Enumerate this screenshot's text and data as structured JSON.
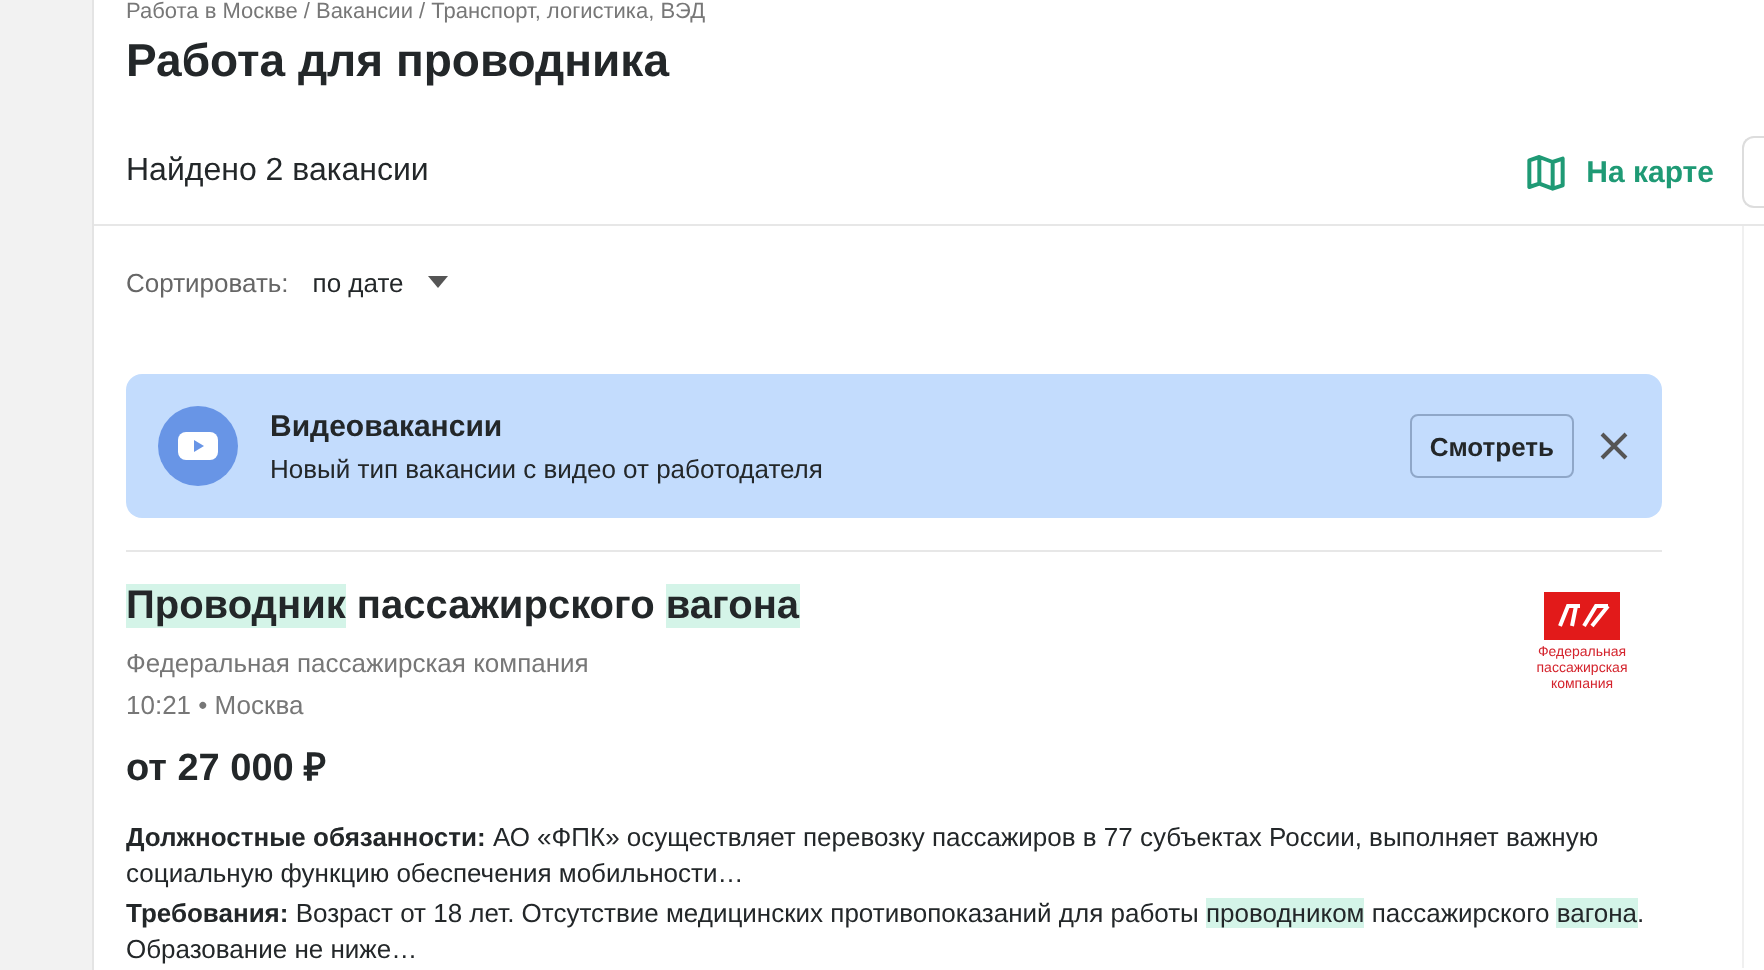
{
  "breadcrumb": "Работа в Москве / Вакансии / Транспорт, логистика, ВЭД",
  "title": "Работа для проводника",
  "found": "Найдено 2 вакансии",
  "map_link": "На карте",
  "sort": {
    "label": "Сортировать:",
    "value": "по дате"
  },
  "banner": {
    "title": "Видеовакансии",
    "text": "Новый тип вакансии с видео от работодателя",
    "button": "Смотреть"
  },
  "vacancy": {
    "title": [
      {
        "text": "Проводник",
        "highlighted": true
      },
      {
        "text": " пассажирского ",
        "highlighted": false
      },
      {
        "text": "вагона",
        "highlighted": true
      }
    ],
    "company": "Федеральная пассажирская компания",
    "logo_caption": "Федеральная пассажирская компания",
    "meta": "10:21 • Москва",
    "salary": "от 27 000 ₽",
    "duties": [
      {
        "text": "**Должностные обязанности:** АО «ФПК» осуществляет перевозку пассажиров в 77 субъектах России, выполняет важную социальную функцию обеспечения мобильности…",
        "highlighted": false
      }
    ],
    "requirements": [
      {
        "text": "**Требования:** Возраст от 18 лет. Отсутствие медицинских противопоказаний для работы ",
        "highlighted": false
      },
      {
        "text": "проводником",
        "highlighted": true
      },
      {
        "text": " пассажирского ",
        "highlighted": false
      },
      {
        "text": "вагона",
        "highlighted": true
      },
      {
        "text": ". Образование не ниже…",
        "highlighted": false
      }
    ]
  }
}
